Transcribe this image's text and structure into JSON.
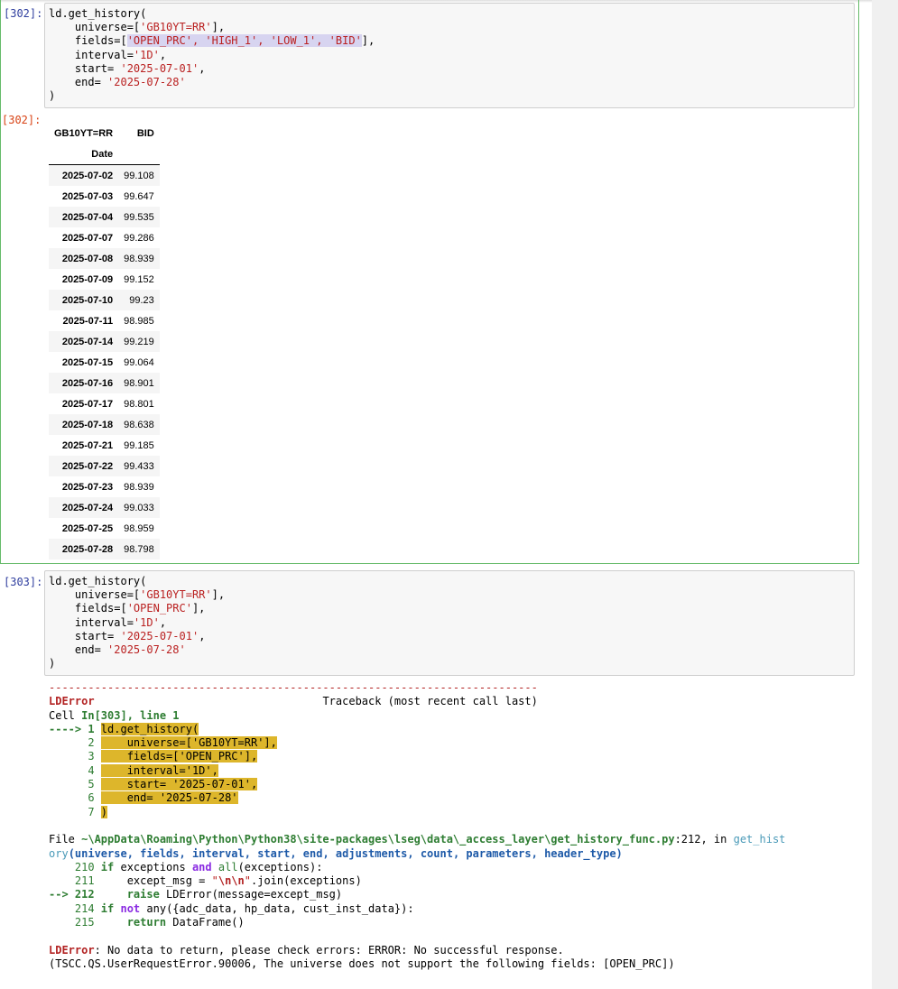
{
  "cell302": {
    "in_prompt": "[302]:",
    "out_prompt": "[302]:",
    "code": {
      "l1": "ld.get_history(",
      "l2a": "    universe=[",
      "l2s": "'GB10YT=RR'",
      "l2b": "],",
      "l3a": "    fields=[",
      "l3s": "'OPEN_PRC', 'HIGH_1', 'LOW_1', 'BID'",
      "l3b": "],",
      "l4a": "    interval=",
      "l4s": "'1D'",
      "l4b": ",",
      "l5a": "    start= ",
      "l5s": "'2025-07-01'",
      "l5b": ",",
      "l6a": "    end= ",
      "l6s": "'2025-07-28'",
      "l7": ")"
    },
    "table": {
      "col_header": "GB10YT=RR",
      "col_value": "BID",
      "index_name": "Date",
      "rows": [
        {
          "date": "2025-07-02",
          "bid": "99.108"
        },
        {
          "date": "2025-07-03",
          "bid": "99.647"
        },
        {
          "date": "2025-07-04",
          "bid": "99.535"
        },
        {
          "date": "2025-07-07",
          "bid": "99.286"
        },
        {
          "date": "2025-07-08",
          "bid": "98.939"
        },
        {
          "date": "2025-07-09",
          "bid": "99.152"
        },
        {
          "date": "2025-07-10",
          "bid": "99.23"
        },
        {
          "date": "2025-07-11",
          "bid": "98.985"
        },
        {
          "date": "2025-07-14",
          "bid": "99.219"
        },
        {
          "date": "2025-07-15",
          "bid": "99.064"
        },
        {
          "date": "2025-07-16",
          "bid": "98.901"
        },
        {
          "date": "2025-07-17",
          "bid": "98.801"
        },
        {
          "date": "2025-07-18",
          "bid": "98.638"
        },
        {
          "date": "2025-07-21",
          "bid": "99.185"
        },
        {
          "date": "2025-07-22",
          "bid": "99.433"
        },
        {
          "date": "2025-07-23",
          "bid": "98.939"
        },
        {
          "date": "2025-07-24",
          "bid": "99.033"
        },
        {
          "date": "2025-07-25",
          "bid": "98.959"
        },
        {
          "date": "2025-07-28",
          "bid": "98.798"
        }
      ]
    }
  },
  "cell303": {
    "in_prompt": "[303]:",
    "code": {
      "l1": "ld.get_history(",
      "l2a": "    universe=[",
      "l2s": "'GB10YT=RR'",
      "l2b": "],",
      "l3a": "    fields=[",
      "l3s": "'OPEN_PRC'",
      "l3b": "],",
      "l4a": "    interval=",
      "l4s": "'1D'",
      "l4b": ",",
      "l5a": "    start= ",
      "l5s": "'2025-07-01'",
      "l5b": ",",
      "l6a": "    end= ",
      "l6s": "'2025-07-28'",
      "l7": ")"
    },
    "traceback": {
      "rule": "---------------------------------------------------------------------------",
      "err_name": "LDError",
      "tb_header": "                                   Traceback (most recent call last)",
      "cell_prefix": "Cell ",
      "cell_ref": "In[303], line 1",
      "arrow1": "----> 1 ",
      "src1": "ld.get_history(",
      "n2": "      2 ",
      "src2": "    universe=['GB10YT=RR'],",
      "n3": "      3 ",
      "src3": "    fields=['OPEN_PRC'],",
      "n4": "      4 ",
      "src4": "    interval='1D',",
      "n5": "      5 ",
      "src5": "    start= '2025-07-01',",
      "n6": "      6 ",
      "src6": "    end= '2025-07-28'",
      "n7": "      7 ",
      "src7": ")",
      "file_prefix": "File ",
      "file_path": "~\\AppData\\Roaming\\Python\\Python38\\site-packages\\lseg\\data\\_access_layer\\get_history_func.py",
      "file_line": ":212",
      "file_in": ", in ",
      "func_a": "get_hist",
      "func_b": "ory",
      "sig": "(universe, fields, interval, start, end, adjustments, count, parameters, header_type)",
      "l210n": "    210 ",
      "l210a": "if",
      "l210b": " exceptions ",
      "l210c": "and",
      "l210d": " ",
      "l210e": "all",
      "l210f": "(exceptions):",
      "l211n": "    211 ",
      "l211a": "    except_msg = ",
      "l211s": "\"",
      "l211esc": "\\n\\n",
      "l211s2": "\"",
      "l211b": ".join(exceptions)",
      "l212n": "--> 212 ",
      "l212a": "    ",
      "l212k": "raise",
      "l212b": " LDError(message=except_msg)",
      "l214n": "    214 ",
      "l214k": "if",
      "l214b": " ",
      "l214c": "not",
      "l214d": " any({adc_data, hp_data, cust_inst_data}):",
      "l215n": "    215 ",
      "l215a": "    ",
      "l215k": "return",
      "l215b": " DataFrame()",
      "msg_name": "LDError",
      "msg1": ": No data to return, please check errors: ERROR: No successful response.",
      "msg2": "(TSCC.QS.UserRequestError.90006, The universe does not support the following fields: [OPEN_PRC])"
    }
  }
}
